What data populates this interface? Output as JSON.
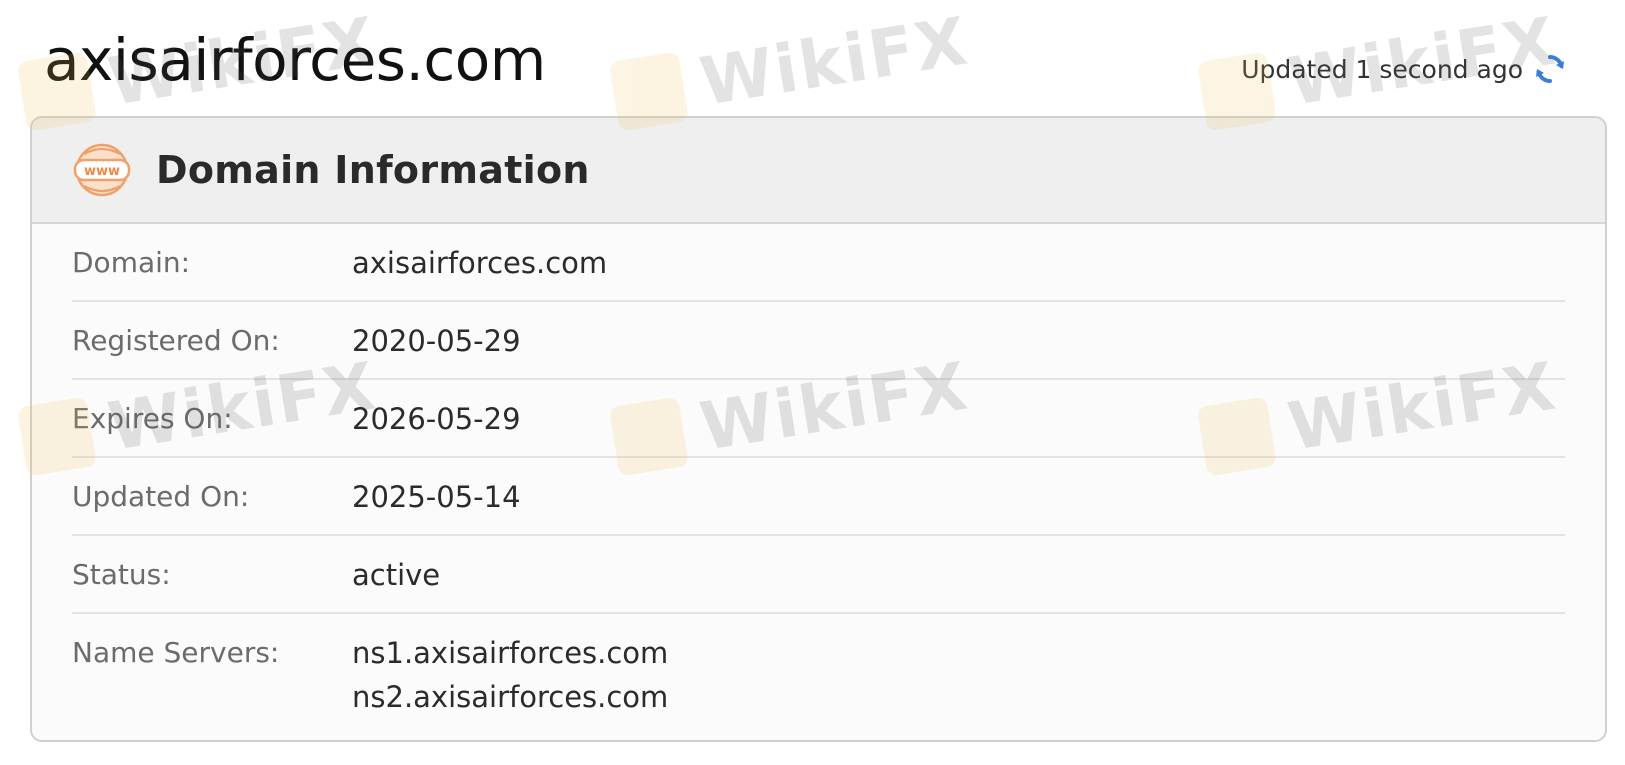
{
  "page": {
    "title": "axisairforces.com",
    "updated_text": "Updated 1 second ago",
    "refresh_icon": "refresh-icon"
  },
  "card": {
    "header_icon": "www-globe-icon",
    "title": "Domain Information",
    "rows": [
      {
        "label": "Domain:",
        "value": "axisairforces.com"
      },
      {
        "label": "Registered On:",
        "value": "2020-05-29"
      },
      {
        "label": "Expires On:",
        "value": "2026-05-29"
      },
      {
        "label": "Updated On:",
        "value": "2025-05-14"
      },
      {
        "label": "Status:",
        "value": "active"
      }
    ],
    "name_servers": {
      "label": "Name Servers:",
      "values": [
        "ns1.axisairforces.com",
        "ns2.axisairforces.com"
      ]
    }
  },
  "watermark": {
    "text": "WikiFX"
  },
  "colors": {
    "accent_orange": "#f0a06a",
    "refresh_blue": "#3b7dd8",
    "header_bg": "#efefef",
    "card_border": "#d0d0d0"
  }
}
